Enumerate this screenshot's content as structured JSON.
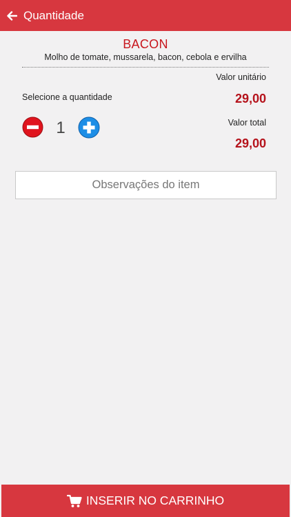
{
  "header": {
    "title": "Quantidade",
    "back_icon": "arrow-left-icon",
    "background": "#d7373f"
  },
  "item": {
    "name": "BACON",
    "description": "Molho de tomate, mussarela, bacon, cebola e ervilha"
  },
  "pricing": {
    "unit_label": "Valor unitário",
    "unit_value": "29,00",
    "total_label": "Valor total",
    "total_value": "29,00",
    "price_color": "#b5121b"
  },
  "quantity": {
    "label": "Selecione a quantidade",
    "value": "1",
    "minus_icon": "minus-circle-icon",
    "plus_icon": "plus-circle-icon"
  },
  "observations": {
    "placeholder": "Observações do item"
  },
  "footer": {
    "cart_label": "INSERIR NO CARRINHO",
    "cart_icon": "cart-icon"
  }
}
